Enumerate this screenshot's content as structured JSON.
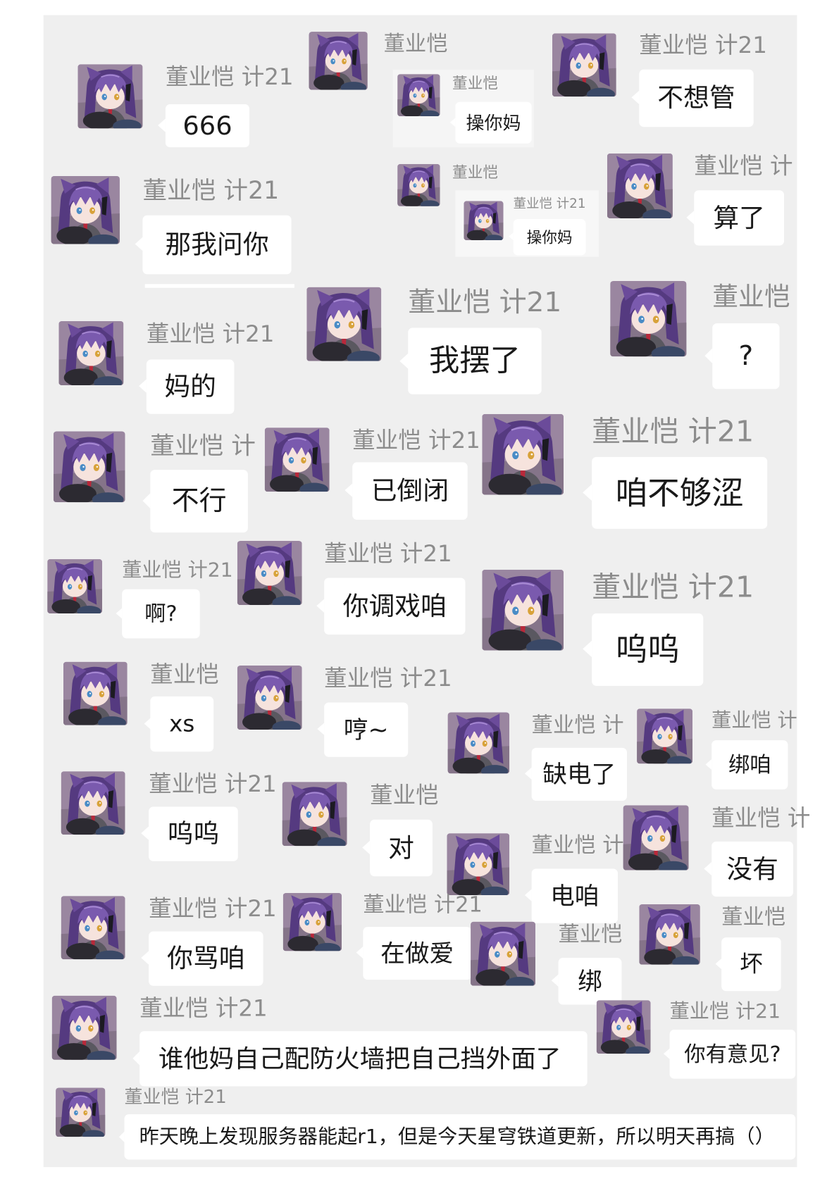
{
  "colors": {
    "page_background": "#ffffff",
    "chat_background": "#efefef",
    "bubble": "#ffffff",
    "name_text": "#8c8c8c",
    "message_text": "#191919",
    "avatar_hair": "#553a80"
  },
  "messages": [
    {
      "name": "董业恺 计21",
      "text": "666"
    },
    {
      "name": "董业恺",
      "quoted": {
        "name": "董业恺",
        "text": "操你妈"
      }
    },
    {
      "name": "董业恺 计21",
      "text": "不想管"
    },
    {
      "name": "董业恺 计21",
      "text": "那我问你"
    },
    {
      "name": "董业恺",
      "quoted": {
        "name": "董业恺 计21",
        "text": "操你妈"
      }
    },
    {
      "name": "董业恺 计",
      "text": "算了"
    },
    {
      "name": "董业恺 计21",
      "text": "我摆了"
    },
    {
      "name": "董业恺",
      "text": "?"
    },
    {
      "name": "董业恺 计21",
      "text": "妈的"
    },
    {
      "name": "董业恺 计",
      "text": "不行"
    },
    {
      "name": "董业恺 计21",
      "text": "已倒闭"
    },
    {
      "name": "董业恺 计21",
      "text": "咱不够涩"
    },
    {
      "name": "董业恺 计21",
      "text": "啊?"
    },
    {
      "name": "董业恺 计21",
      "text": "你调戏咱"
    },
    {
      "name": "董业恺 计21",
      "text": "呜呜"
    },
    {
      "name": "董业恺",
      "text": "xs"
    },
    {
      "name": "董业恺 计21",
      "text": "哼~"
    },
    {
      "name": "董业恺 计",
      "text": "缺电了"
    },
    {
      "name": "董业恺 计",
      "text": "绑咱"
    },
    {
      "name": "董业恺 计21",
      "text": "呜呜"
    },
    {
      "name": "董业恺",
      "text": "对"
    },
    {
      "name": "董业恺 计",
      "text": "没有"
    },
    {
      "name": "董业恺 计",
      "text": "电咱"
    },
    {
      "name": "董业恺 计21",
      "text": "你骂咱"
    },
    {
      "name": "董业恺 计21",
      "text": "在做爱"
    },
    {
      "name": "董业恺",
      "text": "绑"
    },
    {
      "name": "董业恺",
      "text": "坏"
    },
    {
      "name": "董业恺 计21",
      "text": "谁他妈自己配防火墙把自己挡外面了"
    },
    {
      "name": "董业恺 计21",
      "text": "你有意见?"
    },
    {
      "name": "董业恺 计21",
      "text": "昨天晚上发现服务器能起r1，但是今天星穹铁道更新，所以明天再搞（）"
    }
  ]
}
